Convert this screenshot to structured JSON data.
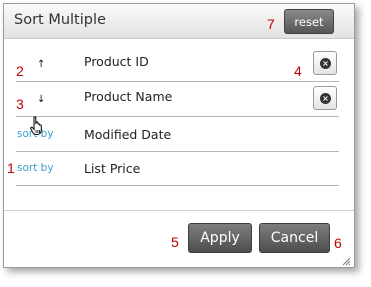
{
  "dialog": {
    "title": "Sort Multiple",
    "reset_label": "reset"
  },
  "rows": [
    {
      "arrow": "↑",
      "column": "Product ID"
    },
    {
      "arrow": "↓",
      "column": "Product Name"
    },
    {
      "sort_by": "sort by",
      "column": "Modified Date"
    },
    {
      "sort_by": "sort by",
      "column": "List Price"
    }
  ],
  "footer": {
    "apply_label": "Apply",
    "cancel_label": "Cancel"
  },
  "callouts": [
    "1",
    "2",
    "3",
    "4",
    "5",
    "6",
    "7"
  ],
  "icons": {
    "remove": "×",
    "cursor": "hand-pointer-icon",
    "resize": "resize-grip-icon"
  },
  "colors": {
    "callout": "#c00000",
    "link": "#3c9ecf",
    "button_dark": "#555555"
  }
}
